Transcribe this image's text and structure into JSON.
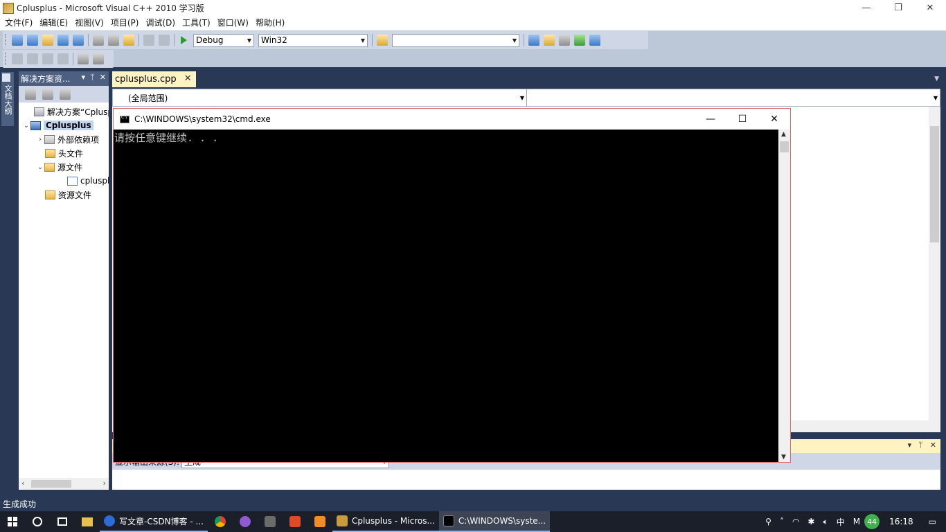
{
  "window": {
    "title": "Cplusplus - Microsoft Visual C++ 2010 学习版",
    "minimize": "—",
    "restore": "❐",
    "close": "✕"
  },
  "menu": [
    "文件(F)",
    "编辑(E)",
    "视图(V)",
    "项目(P)",
    "调试(D)",
    "工具(T)",
    "窗口(W)",
    "帮助(H)"
  ],
  "toolbar": {
    "config": "Debug",
    "platform": "Win32",
    "find_combo": ""
  },
  "left_strip": {
    "tab": "文档大纲"
  },
  "solution_explorer": {
    "title": "解决方案资...",
    "pin": "ᛘ",
    "close": "✕",
    "dropdown": "▾",
    "tree": [
      {
        "label": "解决方案“Cplusplus”",
        "icon": "solution-icon",
        "expander": ""
      },
      {
        "label": "Cplusplus",
        "icon": "project-icon",
        "expander": "⌄"
      },
      {
        "label": "外部依赖项",
        "icon": "references-icon",
        "expander": "›"
      },
      {
        "label": "头文件",
        "icon": "folder-icon",
        "expander": ""
      },
      {
        "label": "源文件",
        "icon": "folder-open-icon",
        "expander": "⌄"
      },
      {
        "label": "cplusplus.cpp",
        "icon": "cpp-file-icon",
        "expander": ""
      },
      {
        "label": "资源文件",
        "icon": "folder-icon",
        "expander": ""
      }
    ],
    "scroll_left": "‹",
    "scroll_right": "›"
  },
  "editor": {
    "tab": "cplusplus.cpp",
    "tab_close": "✕",
    "scope": "(全局范围)",
    "member": ""
  },
  "output": {
    "source_label": "显示输出来源(S):",
    "source_value": "生成"
  },
  "status": {
    "text": "生成成功"
  },
  "cmd": {
    "title": "C:\\WINDOWS\\system32\\cmd.exe",
    "minimize": "—",
    "maximize": "☐",
    "close": "✕",
    "output": "请按任意键继续. . ."
  },
  "taskbar": {
    "items": [
      {
        "label": "写文章-CSDN博客 - ...",
        "color": "#2d6bd6",
        "state": "open"
      },
      {
        "label": "",
        "color": "#e0a82e",
        "state": "normal"
      },
      {
        "label": "",
        "color": "#8e5bd1",
        "state": "normal"
      },
      {
        "label": "",
        "color": "#6b6b6b",
        "state": "normal"
      },
      {
        "label": "",
        "color": "#e04a2a",
        "state": "normal"
      },
      {
        "label": "",
        "color": "#f28c28",
        "state": "normal"
      },
      {
        "label": "Cplusplus - Micros...",
        "color": "#c89b3c",
        "state": "open"
      },
      {
        "label": "C:\\WINDOWS\\syste...",
        "color": "#000000",
        "state": "active"
      }
    ],
    "tray": {
      "ime": "中",
      "badge": "44",
      "time": "16:18"
    }
  }
}
